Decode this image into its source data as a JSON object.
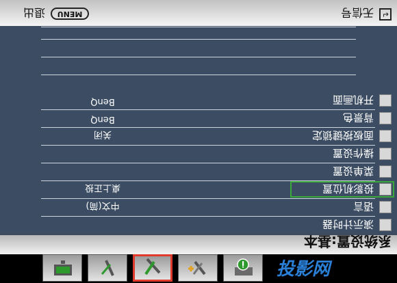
{
  "window": {
    "title": "系统设置:基本"
  },
  "tabs": [
    {
      "name": "tab-image",
      "icon": "monitor-icon"
    },
    {
      "name": "tab-advanced-image",
      "icon": "tools-plus-icon"
    },
    {
      "name": "tab-system-basic",
      "icon": "wrench-screwdriver-icon",
      "active": true
    },
    {
      "name": "tab-system-advanced",
      "icon": "wrench-plus-icon"
    },
    {
      "name": "tab-info",
      "icon": "info-icon"
    }
  ],
  "menu": {
    "items": [
      {
        "label": "演示计时器",
        "value": "",
        "icon": "timer-icon"
      },
      {
        "label": "语言",
        "value": "中文(简)",
        "icon": "globe-icon"
      },
      {
        "label": "投影机位置",
        "value": "桌上正投",
        "icon": "projector-icon",
        "selected": true
      },
      {
        "label": "菜单设置",
        "value": "",
        "icon": "menu-icon"
      },
      {
        "label": "操作设置",
        "value": "",
        "icon": "key-icon"
      },
      {
        "label": "面板按键锁定",
        "value": "关闭",
        "icon": "lock-icon"
      },
      {
        "label": "背景色",
        "value": "BenQ",
        "icon": "color-icon"
      },
      {
        "label": "开机画面",
        "value": "BenQ",
        "icon": "screen-icon"
      }
    ]
  },
  "hints": {
    "source_label": "无信号",
    "menu_key": "MENU",
    "exit_label": "退出"
  },
  "colors": {
    "panel": "#3c4d63",
    "selection": "#3aa83a",
    "active_tab": "#e23a2a"
  }
}
